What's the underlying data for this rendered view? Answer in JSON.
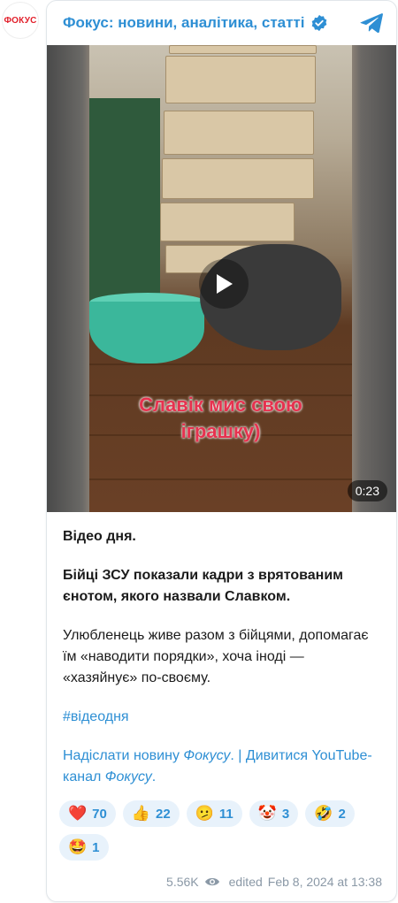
{
  "avatar": {
    "text": "ФОКУС"
  },
  "header": {
    "channel_title": "Фокус: новини, аналітика, статті",
    "verified_icon": "verified-badge-icon",
    "app_icon": "telegram-icon"
  },
  "video": {
    "overlay_line1": "Славік мис свою",
    "overlay_line2": "іграшку)",
    "duration": "0:23"
  },
  "post": {
    "line1": "Відео дня.",
    "line2": "Бійці ЗСУ показали кадри з врятованим єнотом, якого назвали Славком.",
    "line3": "Улюбленець живе разом з бійцями, допомагає їм «наводити порядки», хоча іноді — «хазяйнує» по-своєму.",
    "hashtag": "#відеодня",
    "link1_text": "Надіслати новину ",
    "link1_em": "Фокусу",
    "separator": ". | ",
    "link2_text": "Дивитися YouTube-канал ",
    "link2_em": "Фокусу",
    "link2_end": "."
  },
  "reactions": [
    {
      "emoji": "❤️",
      "icon": "heart-icon",
      "count": "70"
    },
    {
      "emoji": "👍",
      "icon": "thumbs-up-icon",
      "count": "22"
    },
    {
      "emoji": "🫤",
      "icon": "confused-face-icon",
      "count": "11"
    },
    {
      "emoji": "🤡",
      "icon": "clown-face-icon",
      "count": "3"
    },
    {
      "emoji": "🤣",
      "icon": "rofl-face-icon",
      "count": "2"
    },
    {
      "emoji": "🤩",
      "icon": "star-struck-icon",
      "count": "1"
    }
  ],
  "footer": {
    "views": "5.56K",
    "edited": "edited",
    "date": "Feb 8, 2024 at 13:38"
  },
  "colors": {
    "accent": "#2e8fd4",
    "brand_red": "#e2202b",
    "reaction_bg": "#e8f2fb"
  }
}
